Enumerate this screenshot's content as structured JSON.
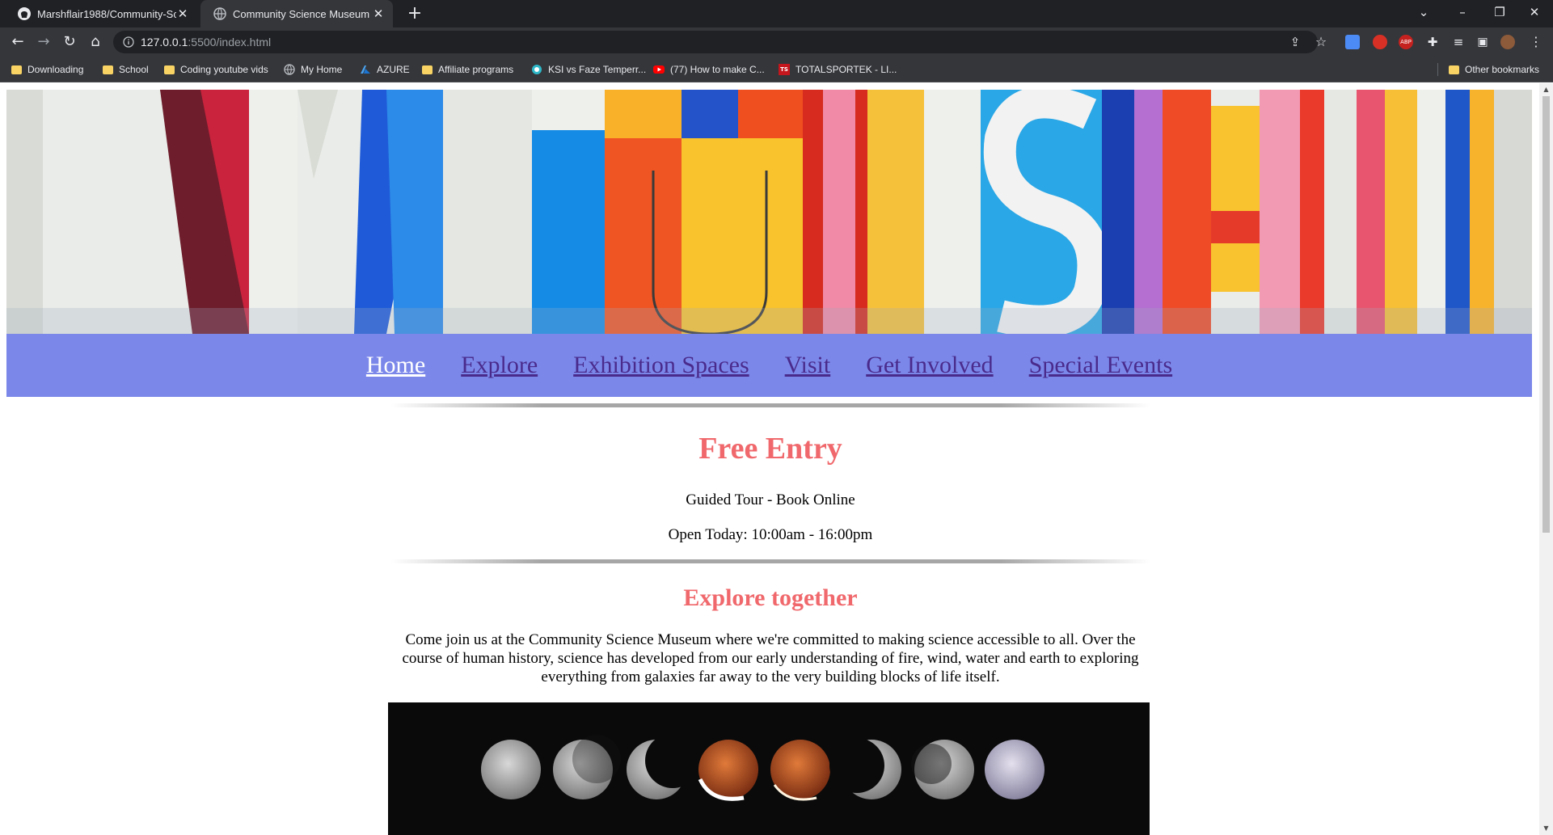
{
  "browser": {
    "tabs": [
      {
        "title": "Marshflair1988/Community-Scien",
        "icon": "github-icon"
      },
      {
        "title": "Community Science Museum",
        "icon": "globe-icon"
      }
    ],
    "url_host": "127.0.0.1",
    "url_rest": ":5500/index.html",
    "bookmarks": [
      {
        "label": "Downloading",
        "icon": "folder-icon"
      },
      {
        "label": "School",
        "icon": "folder-icon"
      },
      {
        "label": "Coding youtube vids",
        "icon": "folder-icon"
      },
      {
        "label": "My Home",
        "icon": "globe-icon"
      },
      {
        "label": "AZURE",
        "icon": "azure-icon"
      },
      {
        "label": "Affiliate programs",
        "icon": "folder-icon"
      },
      {
        "label": "KSI vs Faze Temperr...",
        "icon": "site-icon"
      },
      {
        "label": "(77) How to make C...",
        "icon": "youtube-icon"
      },
      {
        "label": "TOTALSPORTEK - LI...",
        "icon": "ts-icon"
      }
    ],
    "other_bookmarks": "Other bookmarks",
    "ts_badge": "TS",
    "abp_badge": "ABP"
  },
  "nav": {
    "items": [
      "Home",
      "Explore",
      "Exhibition Spaces",
      "Visit",
      "Get Involved",
      "Special Events"
    ]
  },
  "content": {
    "free_title": "Free Entry",
    "tour_line": "Guided Tour - Book Online",
    "open_line": "Open Today: 10:00am - 16:00pm",
    "explore_title": "Explore together",
    "explore_para": "Come join us at the Community Science Museum where we're committed to making science accessible to all. Over the course of human history, science has developed from our early understanding of fire, wind, water and earth to exploring everything from galaxies far away to the very building blocks of life itself."
  },
  "colors": {
    "nav_bg": "#7b88ea",
    "nav_link": "#4a2b8c",
    "heading": "#f0686c"
  }
}
